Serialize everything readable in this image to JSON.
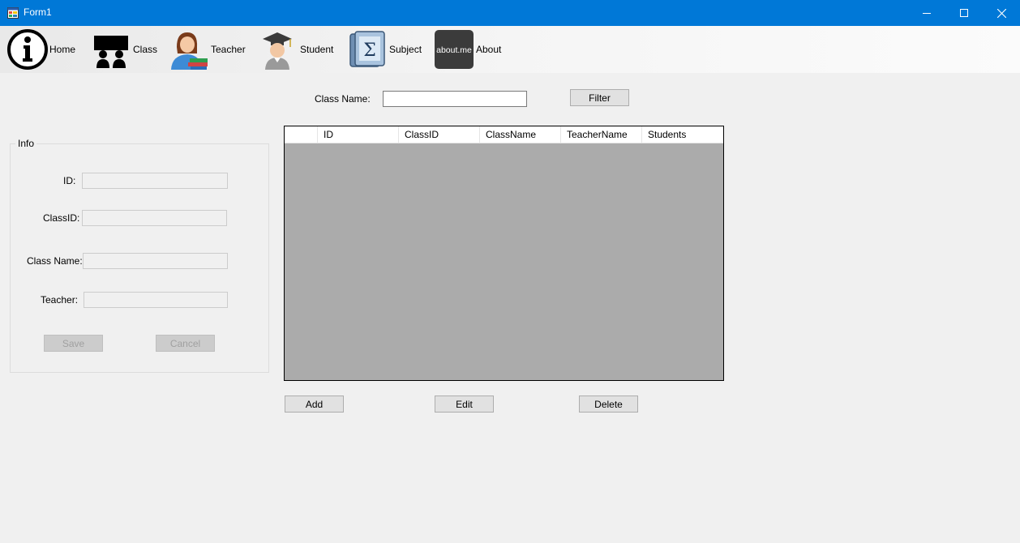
{
  "window": {
    "title": "Form1"
  },
  "menu": {
    "items": [
      {
        "label": "Home",
        "icon": "info-icon"
      },
      {
        "label": "Class",
        "icon": "class-icon"
      },
      {
        "label": "Teacher",
        "icon": "teacher-icon"
      },
      {
        "label": "Student",
        "icon": "student-icon"
      },
      {
        "label": "Subject",
        "icon": "subject-icon"
      },
      {
        "label": "About",
        "icon": "about-icon",
        "badge_text": "about.me"
      }
    ]
  },
  "filter": {
    "label": "Class Name:",
    "value": "",
    "button_label": "Filter"
  },
  "info": {
    "group_title": "Info",
    "fields": [
      {
        "label": "ID:",
        "value": ""
      },
      {
        "label": "ClassID:",
        "value": ""
      },
      {
        "label": "Class Name:",
        "value": ""
      },
      {
        "label": "Teacher:",
        "value": ""
      }
    ],
    "save_label": "Save",
    "cancel_label": "Cancel"
  },
  "grid": {
    "columns": [
      "ID",
      "ClassID",
      "ClassName",
      "TeacherName",
      "Students"
    ],
    "rows": []
  },
  "actions": {
    "add_label": "Add",
    "edit_label": "Edit",
    "delete_label": "Delete"
  },
  "colors": {
    "titlebar": "#0078d7",
    "form_background": "#f0f0f0",
    "grid_background": "#ababab"
  }
}
